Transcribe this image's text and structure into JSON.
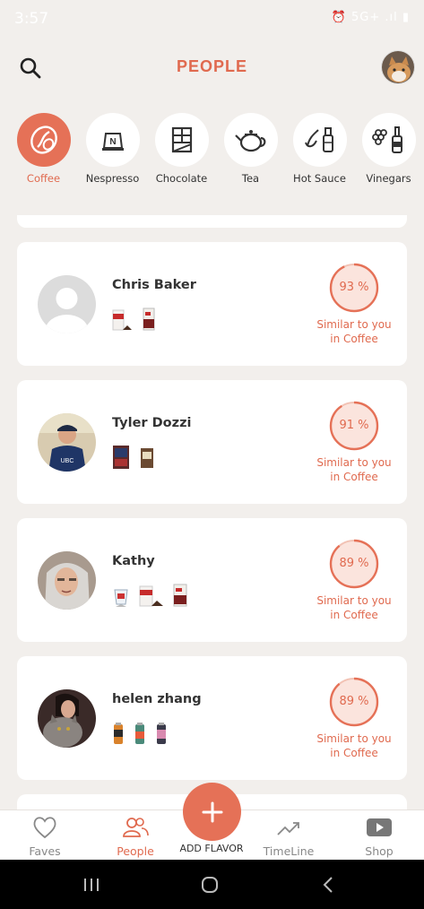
{
  "status": {
    "time": "3:57",
    "right": "⏰ 5G+ .ıl ▮"
  },
  "header": {
    "title": "PEOPLE"
  },
  "categories": [
    {
      "label": "Coffee",
      "icon": "coffee-bean-icon",
      "active": true
    },
    {
      "label": "Nespresso",
      "icon": "nespresso-capsule-icon",
      "active": false
    },
    {
      "label": "Chocolate",
      "icon": "chocolate-bar-icon",
      "active": false
    },
    {
      "label": "Tea",
      "icon": "teapot-icon",
      "active": false
    },
    {
      "label": "Hot Sauce",
      "icon": "hot-sauce-icon",
      "active": false
    },
    {
      "label": "Vinegars",
      "icon": "vinegar-bottle-icon",
      "active": false
    }
  ],
  "people": [
    {
      "name": "Chris Baker",
      "similarity": "93 %",
      "similarity_value": 0.93,
      "similar_line1": "Similar to you",
      "similar_line2": "in Coffee"
    },
    {
      "name": "Tyler Dozzi",
      "similarity": "91 %",
      "similarity_value": 0.91,
      "similar_line1": "Similar to you",
      "similar_line2": "in Coffee"
    },
    {
      "name": "Kathy",
      "similarity": "89 %",
      "similarity_value": 0.89,
      "similar_line1": "Similar to you",
      "similar_line2": "in Coffee"
    },
    {
      "name": "helen zhang",
      "similarity": "89 %",
      "similarity_value": 0.89,
      "similar_line1": "Similar to you",
      "similar_line2": "in Coffee"
    }
  ],
  "bottom_nav": {
    "faves": "Faves",
    "people": "People",
    "add": "ADD FLAVOR",
    "timeline": "TimeLine",
    "shop": "Shop"
  },
  "colors": {
    "accent": "#e57157",
    "accent_text": "#e06a4f",
    "background": "#f2efec"
  }
}
